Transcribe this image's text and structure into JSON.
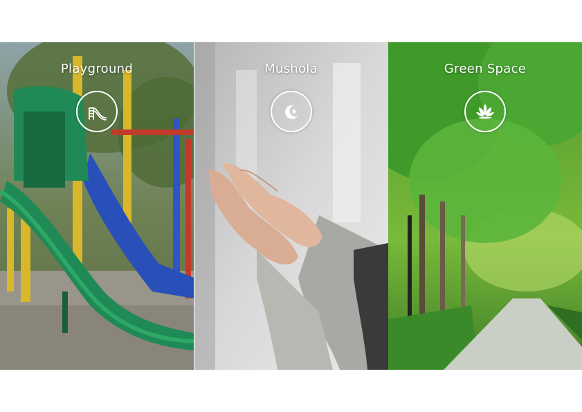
{
  "panels": [
    {
      "title": "Playground",
      "icon": "slide-icon"
    },
    {
      "title": "Mushola",
      "icon": "crescent-star-icon"
    },
    {
      "title": "Green Space",
      "icon": "lotus-icon"
    }
  ],
  "colors": {
    "background": "#ffffff",
    "text": "#ffffff",
    "slide_green": "#1f8a55",
    "slide_blue": "#2950b8",
    "sleeve_gray": "#a8a8a4",
    "foliage_green": "#3f9a2a"
  }
}
